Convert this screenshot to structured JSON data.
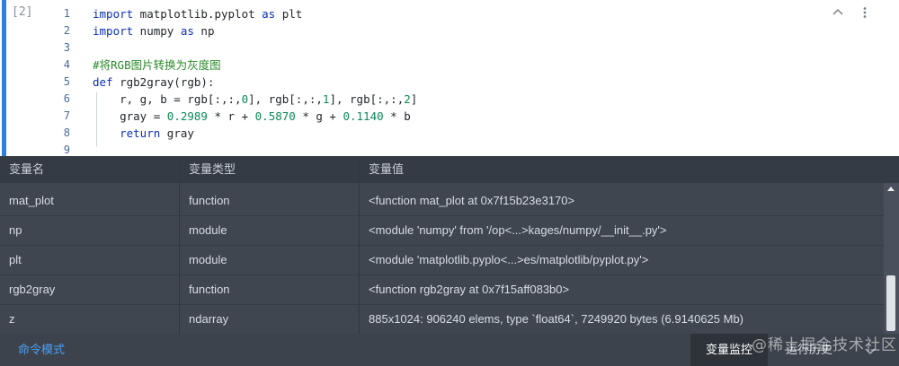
{
  "cell": {
    "prompt": "[2]",
    "lines": [
      {
        "num": "1",
        "tokens": [
          {
            "t": "import",
            "c": "kw"
          },
          {
            "t": " matplotlib.pyplot ",
            "c": ""
          },
          {
            "t": "as",
            "c": "kw"
          },
          {
            "t": " plt",
            "c": ""
          }
        ]
      },
      {
        "num": "2",
        "tokens": [
          {
            "t": "import",
            "c": "kw"
          },
          {
            "t": " numpy ",
            "c": ""
          },
          {
            "t": "as",
            "c": "kw"
          },
          {
            "t": " np",
            "c": ""
          }
        ]
      },
      {
        "num": "3",
        "tokens": []
      },
      {
        "num": "4",
        "tokens": [
          {
            "t": "#将RGB图片转换为灰度图",
            "c": "cm"
          }
        ]
      },
      {
        "num": "5",
        "tokens": [
          {
            "t": "def",
            "c": "kw"
          },
          {
            "t": " rgb2gray(rgb):",
            "c": ""
          }
        ]
      },
      {
        "num": "6",
        "tokens": [
          {
            "t": "    r, g, b = rgb[:,:,",
            "c": ""
          },
          {
            "t": "0",
            "c": "num"
          },
          {
            "t": "], rgb[:,:,",
            "c": ""
          },
          {
            "t": "1",
            "c": "num"
          },
          {
            "t": "], rgb[:,:,",
            "c": ""
          },
          {
            "t": "2",
            "c": "num"
          },
          {
            "t": "]",
            "c": ""
          }
        ]
      },
      {
        "num": "7",
        "tokens": [
          {
            "t": "    gray = ",
            "c": ""
          },
          {
            "t": "0.2989",
            "c": "num"
          },
          {
            "t": " * r + ",
            "c": ""
          },
          {
            "t": "0.5870",
            "c": "num"
          },
          {
            "t": " * g + ",
            "c": ""
          },
          {
            "t": "0.1140",
            "c": "num"
          },
          {
            "t": " * b",
            "c": ""
          }
        ]
      },
      {
        "num": "8",
        "tokens": [
          {
            "t": "    ",
            "c": ""
          },
          {
            "t": "return",
            "c": "kw"
          },
          {
            "t": " gray",
            "c": ""
          }
        ]
      },
      {
        "num": "9",
        "tokens": []
      }
    ]
  },
  "variables": {
    "headers": {
      "name": "变量名",
      "type": "变量类型",
      "value": "变量值"
    },
    "rows": [
      {
        "name": "mat_plot",
        "type": "function",
        "value": "<function mat_plot at 0x7f15b23e3170>"
      },
      {
        "name": "np",
        "type": "module",
        "value": "<module 'numpy' from '/op<...>kages/numpy/__init__.py'>"
      },
      {
        "name": "plt",
        "type": "module",
        "value": "<module 'matplotlib.pyplo<...>es/matplotlib/pyplot.py'>"
      },
      {
        "name": "rgb2gray",
        "type": "function",
        "value": "<function rgb2gray at 0x7f15aff083b0>"
      },
      {
        "name": "z",
        "type": "ndarray",
        "value": "885x1024: 906240 elems, type `float64`, 7249920 bytes (6.9140625 Mb)"
      }
    ]
  },
  "statusbar": {
    "mode_label": "命令模式",
    "tab_monitor": "变量监控",
    "tab_history": "运行历史"
  },
  "watermark": "@稀土掘金技术社区",
  "colors": {
    "accent": "#2f7fe0",
    "keyword": "#0b2fb5",
    "number": "#0a8a55",
    "comment": "#2c8a2c",
    "link": "#4b9ff5"
  }
}
